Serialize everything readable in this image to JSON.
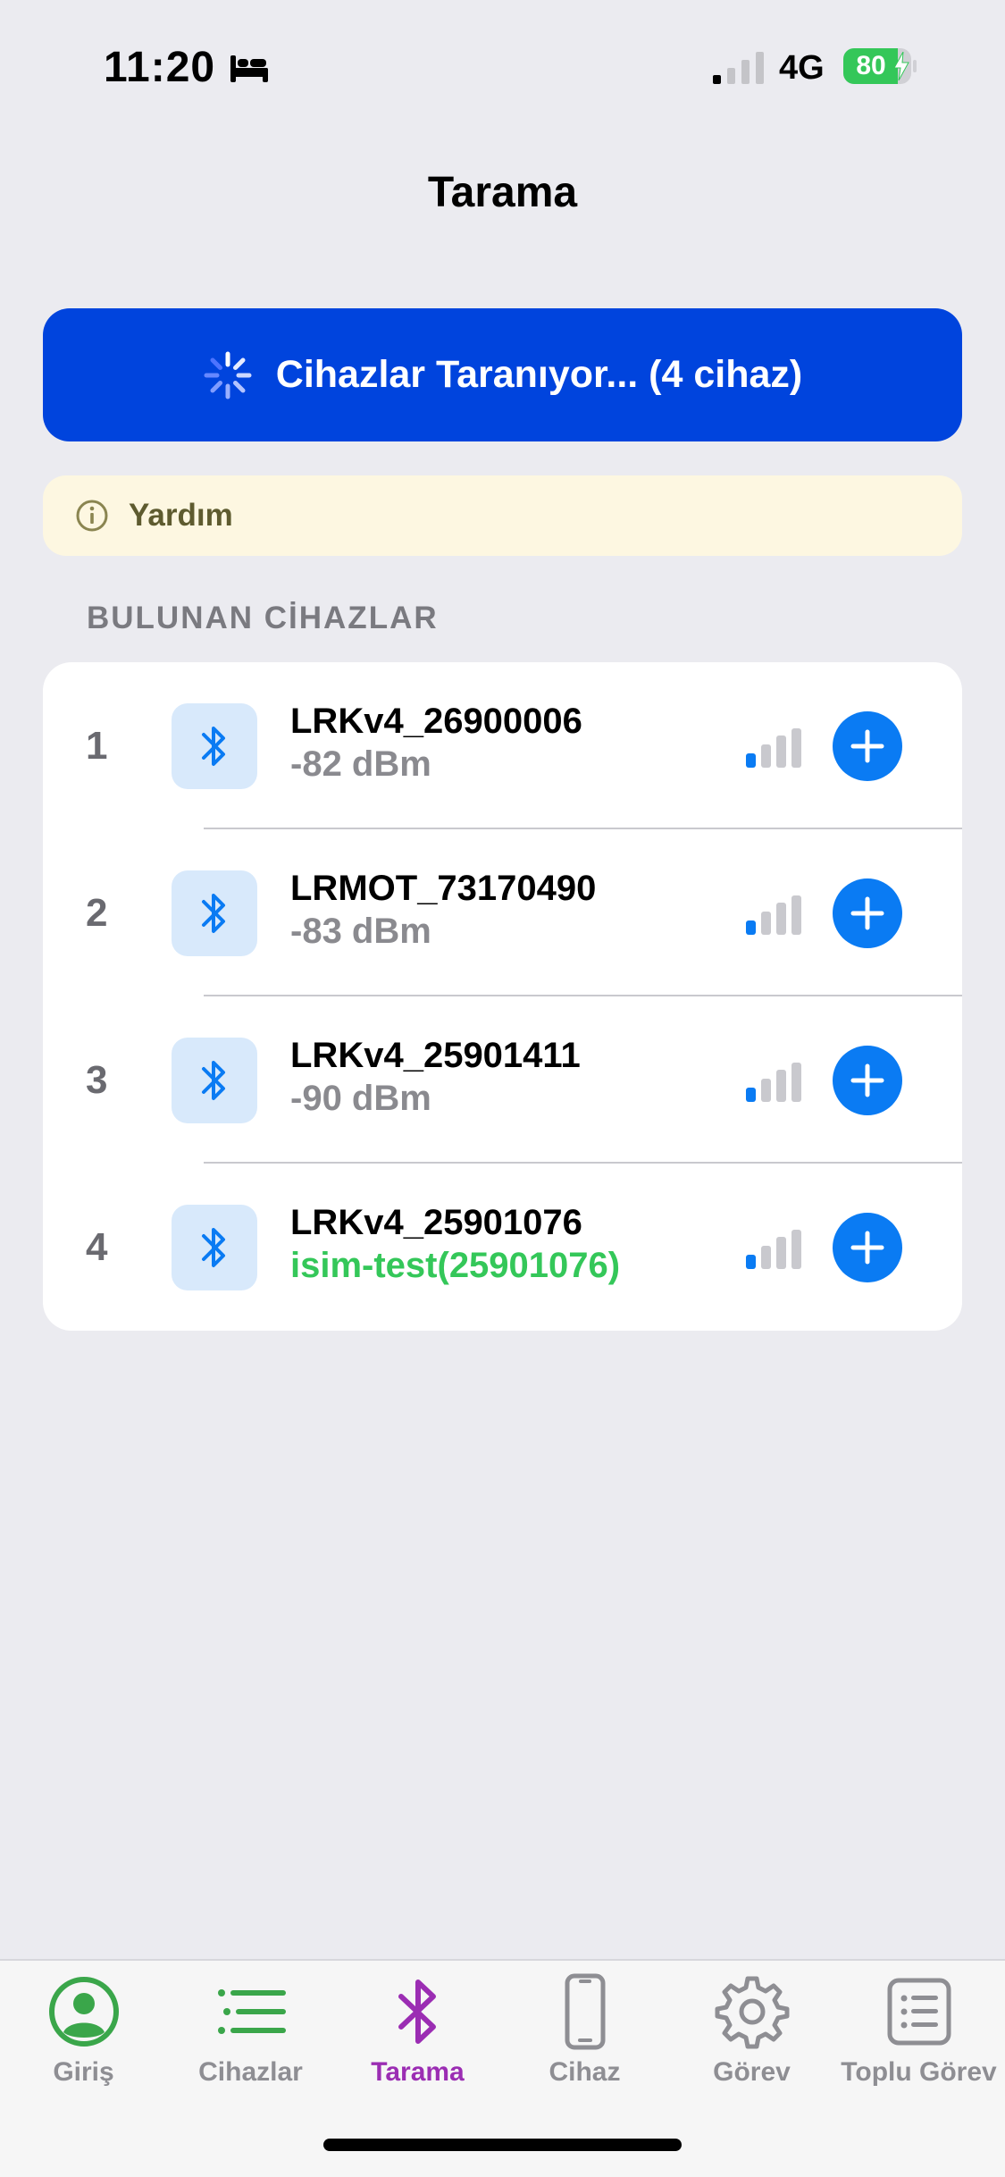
{
  "status_bar": {
    "time": "11:20",
    "network": "4G",
    "battery_percent": "80",
    "battery_level": 0.8,
    "icons": [
      "bed-icon",
      "cellular-signal-icon",
      "battery-charging-icon"
    ]
  },
  "header": {
    "title": "Tarama"
  },
  "scan_button": {
    "label": "Cihazlar Taranıyor... (4 cihaz)",
    "icon": "spinner-icon"
  },
  "help": {
    "label": "Yardım",
    "icon": "info-icon"
  },
  "section": {
    "title": "BULUNAN CİHAZLAR"
  },
  "devices": [
    {
      "index": "1",
      "name": "LRKv4_26900006",
      "detail": "-82 dBm",
      "signal_bars": 1,
      "icon": "bluetooth-icon"
    },
    {
      "index": "2",
      "name": "LRMOT_73170490",
      "detail": "-83 dBm",
      "signal_bars": 1,
      "icon": "bluetooth-icon"
    },
    {
      "index": "3",
      "name": "LRKv4_25901411",
      "detail": "-90 dBm",
      "signal_bars": 1,
      "icon": "bluetooth-icon"
    },
    {
      "index": "4",
      "name": "LRKv4_25901076",
      "detail": "isim-test(25901076)",
      "signal_bars": 1,
      "icon": "bluetooth-icon"
    }
  ],
  "tabs": [
    {
      "label": "Giriş",
      "icon": "person-circle-icon",
      "active": false
    },
    {
      "label": "Cihazlar",
      "icon": "list-icon",
      "active": false
    },
    {
      "label": "Tarama",
      "icon": "bluetooth-icon",
      "active": true
    },
    {
      "label": "Cihaz",
      "icon": "phone-device-icon",
      "active": false
    },
    {
      "label": "Görev",
      "icon": "gear-icon",
      "active": false
    },
    {
      "label": "Toplu Görev",
      "icon": "list-box-icon",
      "active": false
    }
  ],
  "colors": {
    "background": "#ebebf0",
    "scan_button": "#0044dd",
    "help_background": "#fdf7e1",
    "accent_blue": "#0a7bf3",
    "active_tab": "#9b2db3",
    "green": "#34c759",
    "home_tab_icon": "#3aa64a"
  }
}
